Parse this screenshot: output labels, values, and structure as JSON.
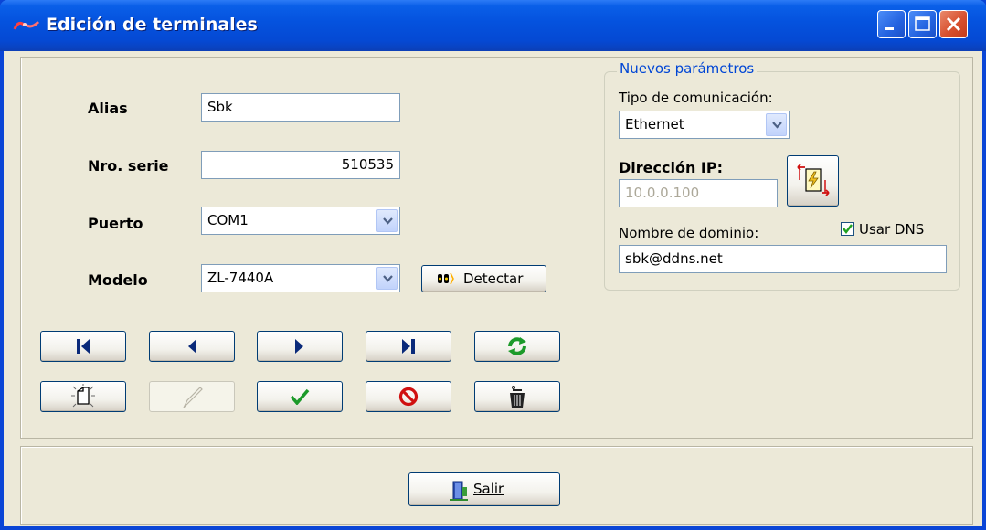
{
  "window": {
    "title": "Edición de terminales",
    "controls": [
      "minimize",
      "maximize",
      "close"
    ]
  },
  "form": {
    "alias_label": "Alias",
    "alias_value": "Sbk",
    "serie_label": "Nro. serie",
    "serie_value": "510535",
    "puerto_label": "Puerto",
    "puerto_value": "COM1",
    "modelo_label": "Modelo",
    "modelo_value": "ZL-7440A",
    "detectar_label": "Detectar"
  },
  "nuevos": {
    "legend": "Nuevos parámetros",
    "tipo_label": "Tipo de comunicación:",
    "tipo_value": "Ethernet",
    "ip_label": "Dirección IP:",
    "ip_value": "10.0.0.100",
    "dominio_label": "Nombre de dominio:",
    "usar_dns_label": "Usar DNS",
    "usar_dns_checked": true,
    "dominio_value": "sbk@ddns.net"
  },
  "nav_buttons": [
    "first-icon",
    "prev-icon",
    "next-icon",
    "last-icon",
    "refresh-icon"
  ],
  "edit_buttons": [
    "new-record-icon",
    "edit-icon",
    "confirm-icon",
    "cancel-icon",
    "delete-icon"
  ],
  "footer": {
    "salir_label": "Salir"
  },
  "colors": {
    "title_bar": "#0553DF",
    "face": "#ECE9D8",
    "nav_arrow": "#0A2A7A",
    "legend": "#0046D5"
  }
}
